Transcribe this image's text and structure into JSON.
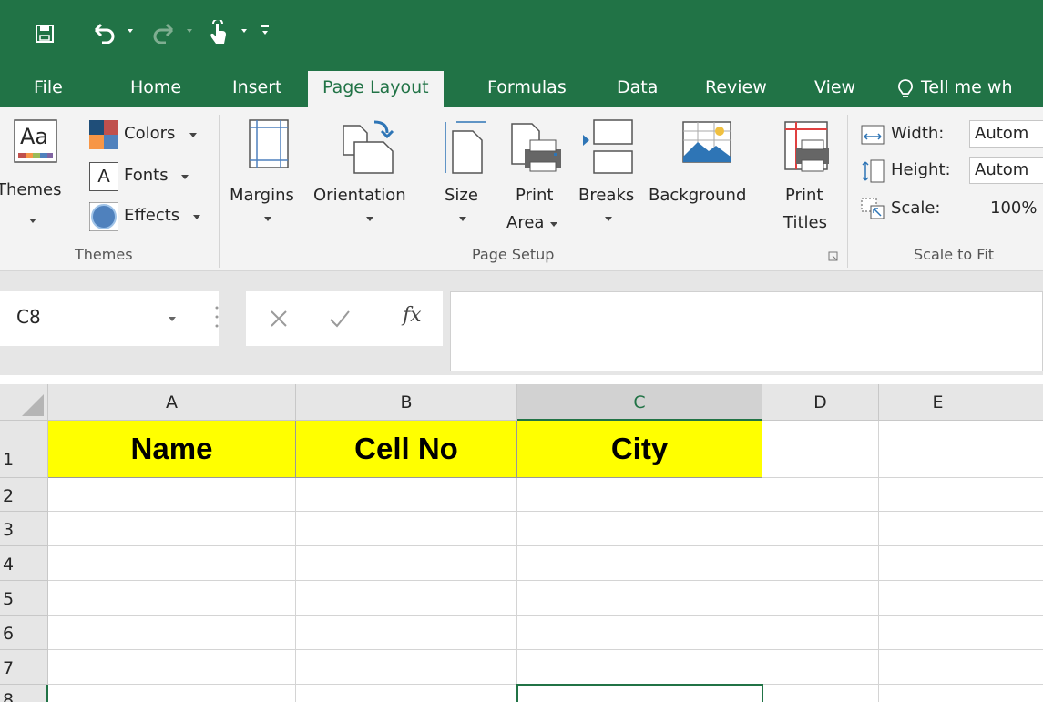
{
  "tabs": [
    "File",
    "Home",
    "Insert",
    "Page Layout",
    "Formulas",
    "Data",
    "Review",
    "View"
  ],
  "active_tab": "Page Layout",
  "tell_me": "Tell me wh",
  "themes_group": {
    "themes_label": "Themes",
    "colors_label": "Colors",
    "fonts_label": "Fonts",
    "effects_label": "Effects",
    "group_label": "Themes",
    "themes_icon_text": "Aa"
  },
  "page_setup": {
    "margins": "Margins",
    "orientation": "Orientation",
    "size": "Size",
    "print_area_1": "Print",
    "print_area_2": "Area",
    "breaks": "Breaks",
    "background": "Background",
    "print_titles_1": "Print",
    "print_titles_2": "Titles",
    "group_label": "Page Setup"
  },
  "scale_to_fit": {
    "width_label": "Width:",
    "width_value": "Autom",
    "height_label": "Height:",
    "height_value": "Autom",
    "scale_label": "Scale:",
    "scale_value": "100%",
    "group_label": "Scale to Fit"
  },
  "formula_bar": {
    "name_box": "C8",
    "fx": "fx",
    "formula": ""
  },
  "columns": [
    "A",
    "B",
    "C",
    "D",
    "E"
  ],
  "selected_column": "C",
  "rows": [
    "1",
    "2",
    "3",
    "4",
    "5",
    "6",
    "7",
    "8"
  ],
  "header_cells": [
    "Name",
    "Cell No",
    "City"
  ],
  "selected_cell": "C8",
  "colors": {
    "excel_green": "#217346",
    "header_fill": "#ffff00"
  }
}
